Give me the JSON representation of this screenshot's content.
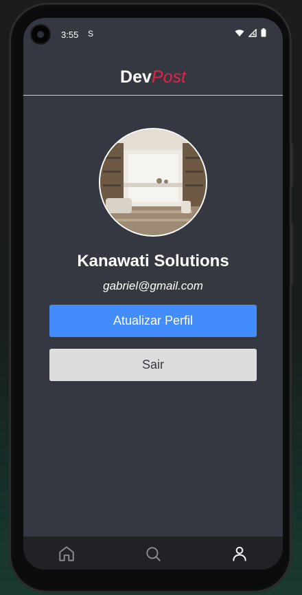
{
  "status_bar": {
    "time": "3:55",
    "indicator": "S"
  },
  "header": {
    "brand_main": "Dev",
    "brand_accent": "Post",
    "accent_color": "#e52246"
  },
  "profile": {
    "name": "Kanawati Solutions",
    "email": "gabriel@gmail.com"
  },
  "buttons": {
    "update": "Atualizar Perfil",
    "logout": "Sair",
    "update_color": "#428cfd",
    "logout_color": "#dddddd"
  },
  "tab_bar": {
    "items": [
      {
        "icon": "home-icon"
      },
      {
        "icon": "search-icon"
      },
      {
        "icon": "profile-icon"
      }
    ]
  },
  "colors": {
    "screen_bg": "#353840",
    "tab_bg": "#202225"
  }
}
